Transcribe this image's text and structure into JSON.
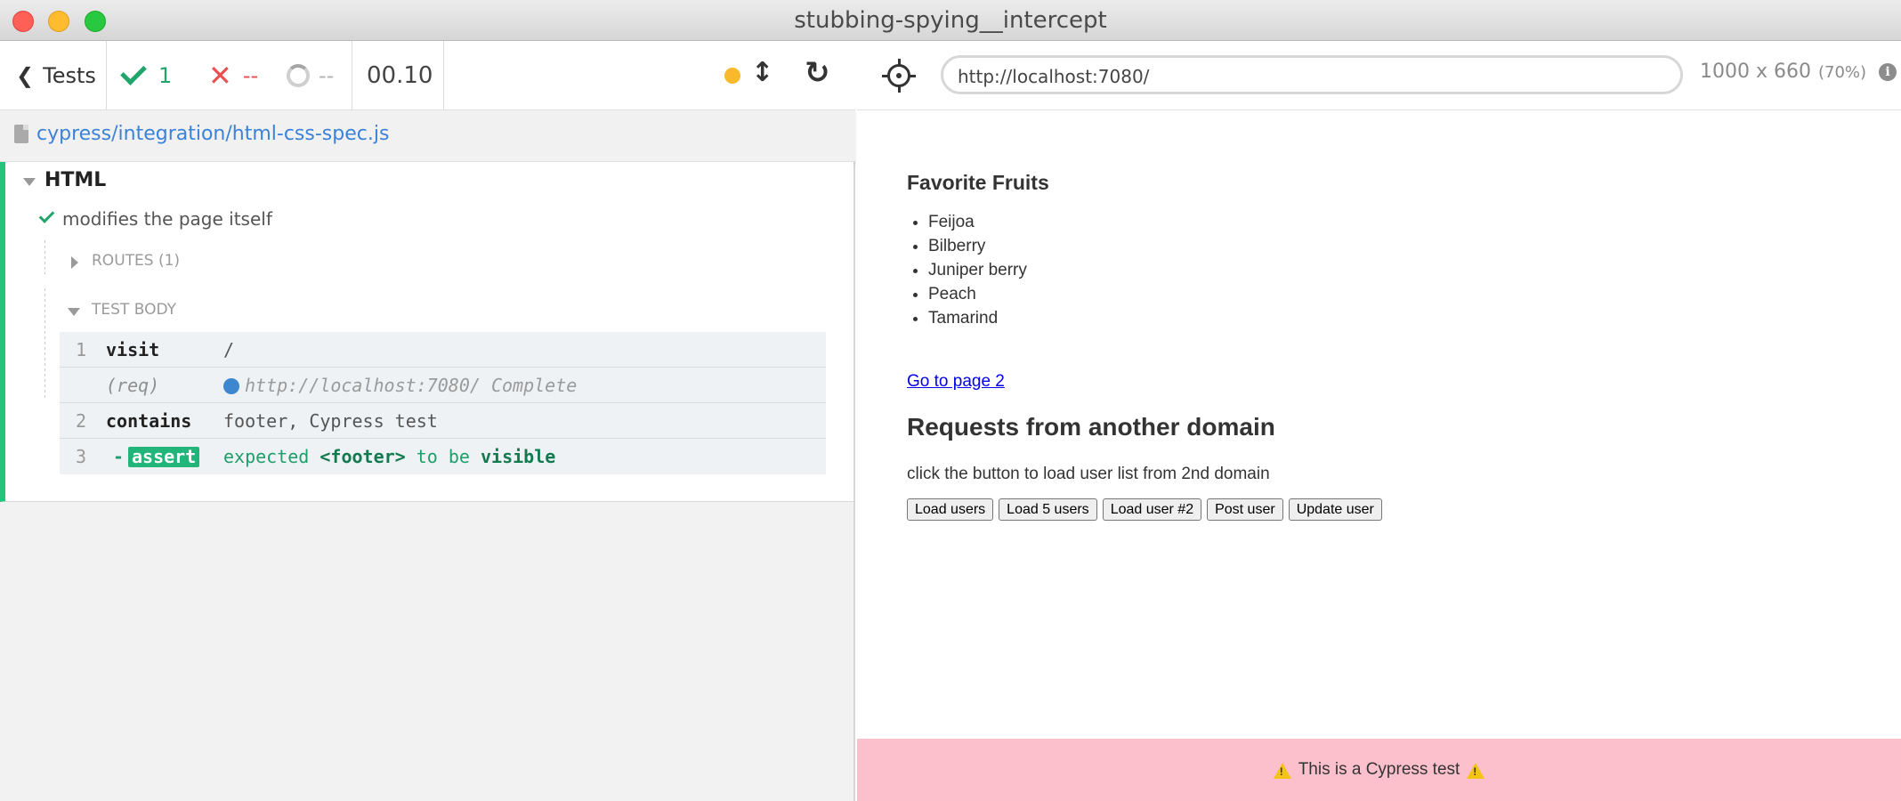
{
  "window": {
    "title": "stubbing-spying__intercept"
  },
  "reporter": {
    "tests_label": "Tests",
    "passed": "1",
    "failed": "--",
    "pending": "--",
    "duration": "00.10",
    "spec_path": "cypress/integration/html-css-spec.js",
    "suite": {
      "title": "HTML"
    },
    "test": {
      "title": "modifies the page itself"
    },
    "routes_label": "ROUTES (1)",
    "test_body_label": "TEST BODY",
    "commands": [
      {
        "num": "1",
        "name": "visit",
        "message": "/"
      },
      {
        "num": "",
        "name": "(req)",
        "message": "http://localhost:7080/ Complete"
      },
      {
        "num": "2",
        "name": "contains",
        "message": "footer, Cypress test"
      },
      {
        "num": "3",
        "name": "assert",
        "message_parts": [
          "expected",
          "<footer>",
          "to be",
          "visible"
        ]
      }
    ]
  },
  "aut_header": {
    "url": "http://localhost:7080/",
    "viewport": "1000 x 660",
    "scale": "(70%)"
  },
  "aut": {
    "fruits_title": "Favorite Fruits",
    "fruits": [
      "Feijoa",
      "Bilberry",
      "Juniper berry",
      "Peach",
      "Tamarind"
    ],
    "page2_link": "Go to page 2",
    "requests_title": "Requests from another domain",
    "requests_desc": "click the button to load user list from 2nd domain",
    "buttons": [
      "Load users",
      "Load 5 users",
      "Load user #2",
      "Post user",
      "Update user"
    ],
    "footer": "This is a Cypress test"
  },
  "colors": {
    "pass": "#22a56c",
    "fail": "#e94f4f",
    "link": "#3b82d8",
    "footer_bg": "#fbc0cb"
  }
}
